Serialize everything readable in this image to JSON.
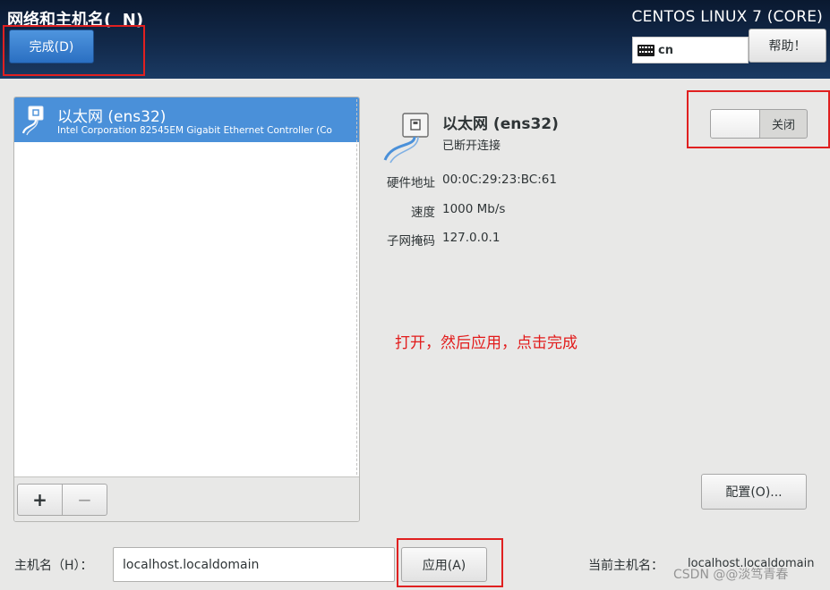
{
  "header": {
    "title": "网络和主机名(  N)",
    "done_button": "完成(D)",
    "product_name": "CENTOS LINUX 7 (CORE)",
    "keyboard_layout": "cn",
    "help_button": "帮助！"
  },
  "device_list": {
    "items": [
      {
        "name": "以太网 (ens32)",
        "description": "Intel Corporation 82545EM Gigabit Ethernet Controller (Co",
        "icon": "ethernet-icon",
        "selected": true
      }
    ],
    "add_button": "+",
    "remove_button": "−"
  },
  "detail": {
    "name": "以太网 (ens32)",
    "status": "已断开连接",
    "switch_label": "关闭",
    "hardware_address_label": "硬件地址",
    "hardware_address": "00:0C:29:23:BC:61",
    "speed_label": "速度",
    "speed": "1000 Mb/s",
    "subnet_mask_label": "子网掩码",
    "subnet_mask": "127.0.0.1",
    "configure_button": "配置(O)..."
  },
  "annotation": {
    "text": "打开，然后应用，点击完成",
    "color": "#e21b1b"
  },
  "hostname": {
    "label": "主机名（H）：",
    "value": "localhost.localdomain",
    "apply_button": "应用(A)",
    "current_label": "当前主机名：",
    "current_value": "localhost.localdomain"
  },
  "watermark": "CSDN @@淡笃青春",
  "colors": {
    "header_bg": "#12294a",
    "accent_blue": "#4a90d9",
    "annotation_red": "#e02020"
  }
}
